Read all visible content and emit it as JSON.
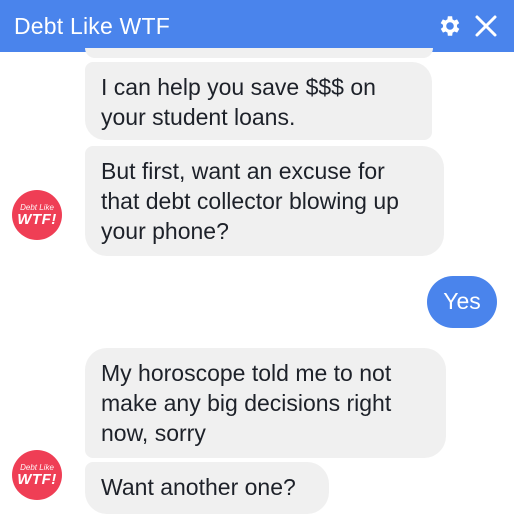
{
  "header": {
    "title": "Debt Like WTF",
    "settings_icon": "gear-icon",
    "close_icon": "close-icon",
    "background_color": "#4a84ec"
  },
  "bot": {
    "avatar_line1": "Debt Like",
    "avatar_line2": "WTF!",
    "avatar_color": "#ef3e55"
  },
  "messages": [
    {
      "sender": "bot",
      "text": "I can help you save $$$ on your student loans."
    },
    {
      "sender": "bot",
      "text": "But first, want an excuse for that debt collector blowing up your phone?"
    },
    {
      "sender": "user",
      "text": "Yes"
    },
    {
      "sender": "bot",
      "text": "My horoscope told me to not make any big decisions right now, sorry"
    },
    {
      "sender": "bot",
      "text": "Want another one?"
    }
  ]
}
